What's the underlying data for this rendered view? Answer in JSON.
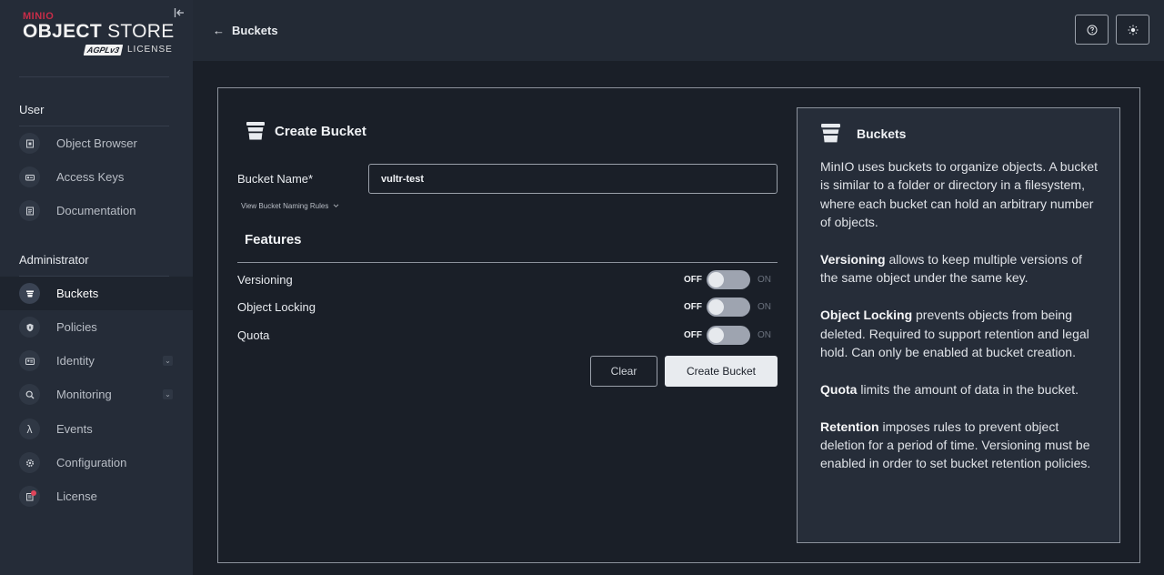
{
  "brand": {
    "top": "MINIO",
    "object": "OBJECT",
    "store": " STORE",
    "agpl": "AGPLv3",
    "license": "LICENSE"
  },
  "sidebar": {
    "user_label": "User",
    "admin_label": "Administrator",
    "user_items": [
      {
        "label": "Object Browser",
        "icon": "object-browser-icon"
      },
      {
        "label": "Access Keys",
        "icon": "access-keys-icon"
      },
      {
        "label": "Documentation",
        "icon": "documentation-icon"
      }
    ],
    "admin_items": [
      {
        "label": "Buckets",
        "icon": "bucket-icon",
        "active": true
      },
      {
        "label": "Policies",
        "icon": "policy-icon"
      },
      {
        "label": "Identity",
        "icon": "identity-icon",
        "expandable": true
      },
      {
        "label": "Monitoring",
        "icon": "monitoring-icon",
        "expandable": true
      },
      {
        "label": "Events",
        "icon": "lambda-icon"
      },
      {
        "label": "Configuration",
        "icon": "gear-icon"
      },
      {
        "label": "License",
        "icon": "license-icon",
        "notification": true
      }
    ]
  },
  "header": {
    "back_label": "Buckets"
  },
  "form": {
    "title": "Create Bucket",
    "bucket_name_label": "Bucket Name*",
    "bucket_name_value": "vultr-test",
    "rules_link": "View Bucket Naming Rules",
    "features_title": "Features",
    "features": [
      {
        "label": "Versioning",
        "off": "OFF",
        "on": "ON",
        "enabled": false
      },
      {
        "label": "Object Locking",
        "off": "OFF",
        "on": "ON",
        "enabled": false
      },
      {
        "label": "Quota",
        "off": "OFF",
        "on": "ON",
        "enabled": false
      }
    ],
    "clear_label": "Clear",
    "create_label": "Create Bucket"
  },
  "help": {
    "title": "Buckets",
    "intro": "MinIO uses buckets to organize objects. A bucket is similar to a folder or directory in a filesystem, where each bucket can hold an arbitrary number of objects.",
    "items": [
      {
        "term": "Versioning",
        "text": " allows to keep multiple versions of the same object under the same key."
      },
      {
        "term": "Object Locking",
        "text": " prevents objects from being deleted. Required to support retention and legal hold. Can only be enabled at bucket creation."
      },
      {
        "term": "Quota",
        "text": " limits the amount of data in the bucket."
      },
      {
        "term": "Retention",
        "text": " imposes rules to prevent object deletion for a period of time. Versioning must be enabled in order to set bucket retention policies."
      }
    ]
  },
  "colors": {
    "accent_red": "#c72c48",
    "background": "#1a1f28",
    "sidebar": "#252c38"
  }
}
